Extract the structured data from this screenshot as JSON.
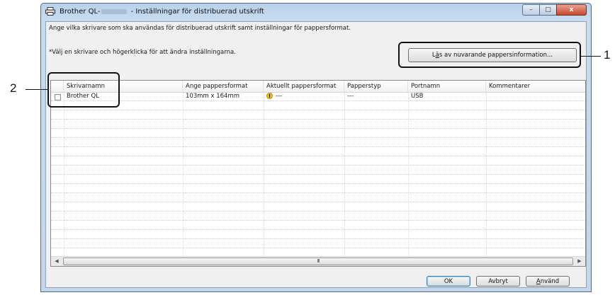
{
  "window": {
    "title_prefix": "Brother QL-",
    "title_suffix": " - Inställningar för distribuerad utskrift",
    "controls": {
      "minimize": "–",
      "maximize": "□",
      "close": "x"
    }
  },
  "description": "Ange vilka skrivare som ska användas för distribuerad utskrift samt inställningar för pappersformat.",
  "hint": "*Välj en skrivare och högerklicka för att ändra inställningarna.",
  "read_button": {
    "pre": "L",
    "key": "ä",
    "post": "s av nuvarande pappersinformation..."
  },
  "table": {
    "columns": [
      "Skrivarnamn",
      "Ange pappersformat",
      "Aktuellt pappersformat",
      "Papperstyp",
      "Portnamn",
      "Kommentarer"
    ],
    "rows": [
      {
        "checked": false,
        "name": "Brother QL",
        "paper_format": "103mm x 164mm",
        "current_format": "---",
        "paper_type": "---",
        "port": "USB",
        "comment": ""
      }
    ],
    "warning_icon": "warning-icon"
  },
  "scrollbar": {
    "left": "◀",
    "right": "▶",
    "thumb_grip": "III"
  },
  "buttons": {
    "ok": "OK",
    "cancel": "Avbryt",
    "apply": {
      "key": "A",
      "rest": "nvänd"
    }
  },
  "callouts": {
    "one": "1",
    "two": "2"
  }
}
